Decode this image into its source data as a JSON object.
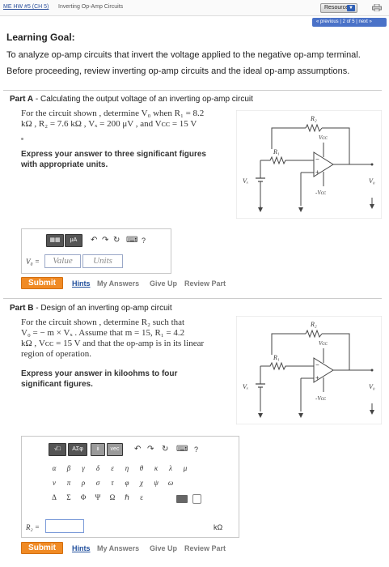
{
  "topbar": {
    "breadcrumb": "ME HW #5 (CH 5)",
    "title": "Inverting Op-Amp Circuits",
    "resources": "Resources",
    "pager": "« previous  |  2 of 5  |  next »"
  },
  "goal": {
    "heading": "Learning Goal:",
    "text1": "To analyze op-amp circuits that invert the voltage applied to the negative op-amp terminal.",
    "text2": "Before proceeding, review inverting op-amp circuits and the ideal op-amp assumptions."
  },
  "partA": {
    "label": "Part A",
    "title": " - Calculating the output voltage of an inverting op-amp circuit",
    "q_line1": "For the circuit shown , determine V₀ when R₁ = 8.2",
    "q_line2": "kΩ , R₂ = 7.6 kΩ , Vₓ = 200 μV , and Vᴄᴄ = 15 V",
    "instr1": "Express your answer to three significant figures",
    "instr2": "with appropriate units.",
    "toolbar_mu": "μA",
    "toolbar_help": "?",
    "answer_label": "V₀ =",
    "value_placeholder": "Value",
    "units_placeholder": "Units"
  },
  "partB": {
    "label": "Part B",
    "title": " - Design of an inverting op-amp circuit",
    "q_line1": "For the circuit shown , determine R₂ such that",
    "q_line2": "V₀ = − m × Vₓ . Assume that m = 15, R₁ = 4.2",
    "q_line3": "kΩ , Vᴄᴄ = 15 V and that the op-amp is in its linear",
    "q_line4": "region of operation.",
    "instr1": "Express your answer in kiloohms to four",
    "instr2": "significant figures.",
    "toolbar_sqrt": "√□",
    "toolbar_greek": "AΣφ",
    "toolbar_ii": "ii",
    "toolbar_vec": "vec",
    "toolbar_help": "?",
    "greek_row1": [
      "α",
      "β",
      "γ",
      "δ",
      "ε",
      "η",
      "θ",
      "κ",
      "λ",
      "μ"
    ],
    "greek_row2": [
      "ν",
      "π",
      "ρ",
      "σ",
      "τ",
      "φ",
      "χ",
      "ψ",
      "ω"
    ],
    "greek_row3": [
      "Δ",
      "Σ",
      "Φ",
      "Ψ",
      "Ω",
      "ℏ",
      "ε"
    ],
    "answer_label": "R₂ =",
    "units": "kΩ"
  },
  "actions": {
    "submit": "Submit",
    "hints": "Hints",
    "my_answers": "My Answers",
    "give_up": "Give Up",
    "review_part": "Review Part"
  },
  "circuit": {
    "r2": "R₂",
    "r1": "R₁",
    "vcc_plus": "Vᴄᴄ",
    "vcc_minus": "-Vᴄᴄ",
    "vs": "Vₓ",
    "vo": "V₀"
  }
}
